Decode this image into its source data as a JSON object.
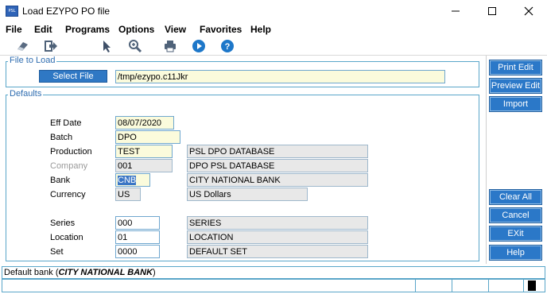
{
  "window": {
    "title": "Load EZYPO PO file",
    "app_icon_text": "PSL"
  },
  "menu": [
    "File",
    "Edit",
    "Programs",
    "Options",
    "View",
    "Favorites",
    "Help"
  ],
  "toolbar_icons": [
    "eraser-icon",
    "exit-arrow-icon",
    "cursor-icon",
    "zoom-in-icon",
    "print-icon",
    "play-icon",
    "help-icon"
  ],
  "file_to_load": {
    "title": "File to Load",
    "select_label": "Select File",
    "path": "/tmp/ezypo.c11Jkr"
  },
  "defaults": {
    "title": "Defaults",
    "rows": [
      {
        "label": "Eff Date",
        "value": "08/07/2020"
      },
      {
        "label": "Batch",
        "value": "DPO"
      },
      {
        "label": "Production",
        "value": "TEST",
        "desc": "PSL DPO DATABASE"
      },
      {
        "label": "Company",
        "value": "001",
        "desc": "DPO PSL DATABASE"
      },
      {
        "label": "Bank",
        "value": "CNB",
        "desc": "CITY NATIONAL BANK"
      },
      {
        "label": "Currency",
        "value": "US",
        "desc": "US Dollars"
      },
      {
        "label": "Series",
        "value": "000",
        "desc": "SERIES"
      },
      {
        "label": "Location",
        "value": "01",
        "desc": "LOCATION"
      },
      {
        "label": "Set",
        "value": "0000",
        "desc": "DEFAULT SET"
      }
    ]
  },
  "sidebar": {
    "print_edit": "Print Edit",
    "preview_edit": "Preview Edit",
    "import": "Import",
    "clear_all": "Clear All",
    "cancel": "Cancel",
    "exit": "EXit",
    "help": "Help"
  },
  "status": {
    "prefix": "Default bank (",
    "bank_name": "CITY NATIONAL BANK",
    "suffix": ")"
  }
}
